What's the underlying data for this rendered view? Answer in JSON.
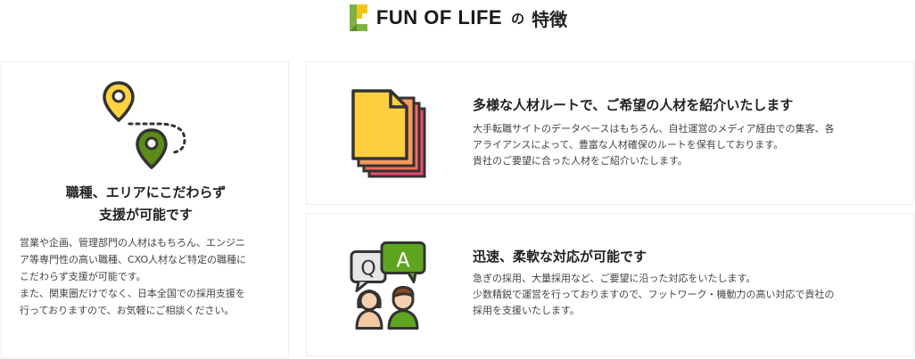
{
  "header": {
    "brand": "FUN OF LIFE",
    "connector": "の",
    "feature": "特徴"
  },
  "colors": {
    "logo_green": "#7cb342",
    "logo_yellow": "#f5c518",
    "pin_yellow": "#ffd23f",
    "pin_green": "#5b8c1a",
    "doc_yellow": "#ffcf3f",
    "doc_orange": "#f79a5a",
    "doc_red": "#f26b5a",
    "doc_pink": "#ef4a73",
    "bubble_green": "#5ea51f",
    "bubble_gray": "#e6e6e6"
  },
  "cards": {
    "left": {
      "icon": "location-pins-icon",
      "title_lines": [
        "職種、エリアにこだわらず",
        "支援が可能です"
      ],
      "body_lines": [
        "営業や企画、管理部門の人材はもちろん、エンジニ",
        "ア等専門性の高い職種、CXO人材など特定の職種に",
        "こだわらず支援が可能です。",
        "また、関東圏だけでなく、日本全国での採用支援を",
        "行っておりますので、お気軽にご相談ください。"
      ]
    },
    "route": {
      "icon": "stacked-documents-icon",
      "title": "多様な人材ルートで、ご希望の人材を紹介いたします",
      "body_lines": [
        "大手転職サイトのデータベースはもちろん、自社運営のメディア経由での集客、各",
        "アライアンスによって、豊富な人材確保のルートを保有しております。",
        "貴社のご要望に合った人材をご紹介いたします。"
      ]
    },
    "speed": {
      "icon": "qa-chat-people-icon",
      "bubble_q": "Q",
      "bubble_a": "A",
      "title": "迅速、柔軟な対応が可能です",
      "body_lines": [
        "急ぎの採用、大量採用など、ご要望に沿った対応をいたします。",
        "少数精鋭で運営を行っておりますので、フットワーク・機動力の高い対応で貴社の",
        "採用を支援いたします。"
      ]
    }
  }
}
